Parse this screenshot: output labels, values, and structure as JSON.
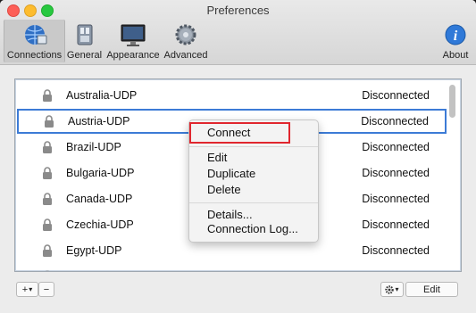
{
  "window": {
    "title": "Preferences"
  },
  "toolbar": {
    "items": [
      {
        "label": "Connections",
        "icon": "globe-network-icon"
      },
      {
        "label": "General",
        "icon": "switch-panel-icon"
      },
      {
        "label": "Appearance",
        "icon": "monitor-icon"
      },
      {
        "label": "Advanced",
        "icon": "gear-icon"
      },
      {
        "label": "About",
        "icon": "info-icon"
      }
    ]
  },
  "connections": [
    {
      "name": "Australia-UDP",
      "status": "Disconnected"
    },
    {
      "name": "Austria-UDP",
      "status": "Disconnected"
    },
    {
      "name": "Brazil-UDP",
      "status": "Disconnected"
    },
    {
      "name": "Bulgaria-UDP",
      "status": "Disconnected"
    },
    {
      "name": "Canada-UDP",
      "status": "Disconnected"
    },
    {
      "name": "Czechia-UDP",
      "status": "Disconnected"
    },
    {
      "name": "Egypt-UDP",
      "status": "Disconnected"
    }
  ],
  "context_menu": {
    "connect": "Connect",
    "edit": "Edit",
    "duplicate": "Duplicate",
    "delete": "Delete",
    "details": "Details...",
    "connection_log": "Connection Log..."
  },
  "bottom": {
    "add": "+",
    "add_arrow": "▾",
    "remove": "−",
    "action_arrow": "▾",
    "edit": "Edit"
  },
  "colors": {
    "selection_border": "#3c7bd6",
    "highlight_box": "#e0262e"
  }
}
